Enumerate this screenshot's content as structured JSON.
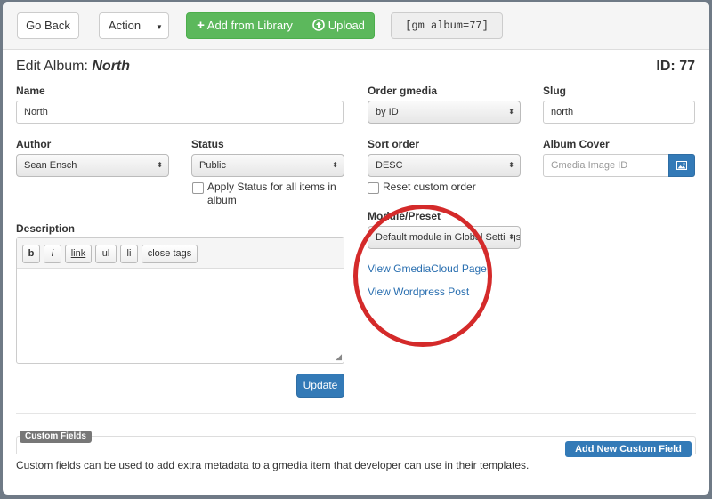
{
  "toolbar": {
    "go_back": "Go Back",
    "action": "Action",
    "add_from_library": "Add from Library",
    "upload": "Upload",
    "shortcode": "[gm album=77]"
  },
  "header": {
    "title_prefix": "Edit Album: ",
    "album_name": "North",
    "id_label": "ID: 77"
  },
  "form": {
    "name_label": "Name",
    "name_value": "North",
    "order_label": "Order gmedia",
    "order_value": "by ID",
    "slug_label": "Slug",
    "slug_value": "north",
    "author_label": "Author",
    "author_value": "Sean Ensch",
    "status_label": "Status",
    "status_value": "Public",
    "apply_status_line1": "Apply Status for all items in",
    "apply_status_line2": "album",
    "sort_label": "Sort order",
    "sort_value": "DESC",
    "reset_order": "Reset custom order",
    "cover_label": "Album Cover",
    "cover_placeholder": "Gmedia Image ID",
    "module_label": "Module/Preset",
    "module_value": "Default module in Global Settings",
    "view_cloud": "View GmediaCloud Page",
    "view_post": "View Wordpress Post",
    "description_label": "Description",
    "editor_buttons": [
      "b",
      "i",
      "link",
      "ul",
      "li",
      "close tags"
    ],
    "update": "Update"
  },
  "custom_fields": {
    "tag": "Custom Fields",
    "add_button": "Add New Custom Field",
    "help_text": "Custom fields can be used to add extra metadata to a gmedia item that developer can use in their templates."
  },
  "colors": {
    "green": "#5cb85c",
    "blue": "#337ab7",
    "annotation_red": "#d42a2a",
    "link": "#2a6fb0"
  }
}
